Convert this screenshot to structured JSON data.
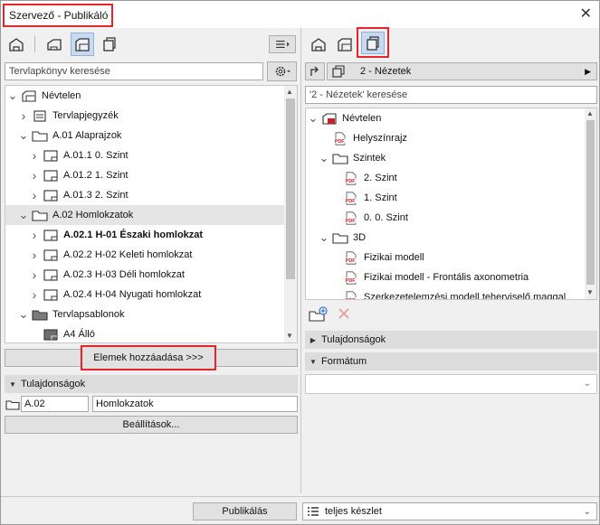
{
  "window": {
    "title": "Szervező - Publikáló",
    "close_glyph": "✕"
  },
  "left": {
    "toolbar": {
      "icons": [
        "project-map-icon",
        "view-map-icon",
        "layout-book-icon",
        "publisher-sets-icon",
        "menu-icon"
      ]
    },
    "search_placeholder": "Tervlapkönyv keresése",
    "tree": [
      {
        "label": "Névtelen",
        "level": 0,
        "twisty": "open",
        "icon": "book-icon",
        "bold": false,
        "highlight": false
      },
      {
        "label": "Tervlapjegyzék",
        "level": 1,
        "twisty": "closed",
        "icon": "layout-list-icon",
        "bold": false,
        "highlight": false
      },
      {
        "label": "A.01 Alaprajzok",
        "level": 1,
        "twisty": "open",
        "icon": "folder-icon",
        "bold": false,
        "highlight": false
      },
      {
        "label": "A.01.1 0. Szint",
        "level": 2,
        "twisty": "closed",
        "icon": "layout-icon",
        "bold": false,
        "highlight": false
      },
      {
        "label": "A.01.2 1. Szint",
        "level": 2,
        "twisty": "closed",
        "icon": "layout-icon",
        "bold": false,
        "highlight": false
      },
      {
        "label": "A.01.3 2. Szint",
        "level": 2,
        "twisty": "closed",
        "icon": "layout-icon",
        "bold": false,
        "highlight": false
      },
      {
        "label": "A.02 Homlokzatok",
        "level": 1,
        "twisty": "open",
        "icon": "folder-icon",
        "bold": false,
        "highlight": true
      },
      {
        "label": "A.02.1 H-01 Északi homlokzat",
        "level": 2,
        "twisty": "closed",
        "icon": "layout-icon",
        "bold": true,
        "highlight": false
      },
      {
        "label": "A.02.2 H-02 Keleti homlokzat",
        "level": 2,
        "twisty": "closed",
        "icon": "layout-icon",
        "bold": false,
        "highlight": false
      },
      {
        "label": "A.02.3 H-03 Déli homlokzat",
        "level": 2,
        "twisty": "closed",
        "icon": "layout-icon",
        "bold": false,
        "highlight": false
      },
      {
        "label": "A.02.4 H-04 Nyugati homlokzat",
        "level": 2,
        "twisty": "closed",
        "icon": "layout-icon",
        "bold": false,
        "highlight": false
      },
      {
        "label": "Tervlapsablonok",
        "level": 1,
        "twisty": "open",
        "icon": "folder-dark-icon",
        "bold": false,
        "highlight": false
      },
      {
        "label": "A4 Álló",
        "level": 2,
        "twisty": "none",
        "icon": "master-layout-icon",
        "bold": false,
        "highlight": false
      }
    ],
    "add_button": "Elemek hozzáadása >>>",
    "properties_header": "Tulajdonságok",
    "prop_id": "A.02",
    "prop_name": "Homlokzatok",
    "settings_button": "Beállítások..."
  },
  "right": {
    "toolbar": {
      "icons": [
        "project-map-icon",
        "layout-book-icon",
        "publisher-sets-icon"
      ]
    },
    "set_selector": "2 - Nézetek",
    "search_placeholder": "'2 - Nézetek' keresése",
    "tree": [
      {
        "label": "Névtelen",
        "level": 0,
        "twisty": "open",
        "icon": "publisher-root-icon"
      },
      {
        "label": "Helyszínrajz",
        "level": 1,
        "twisty": "none",
        "icon": "pdf-icon"
      },
      {
        "label": "Szintek",
        "level": 1,
        "twisty": "open",
        "icon": "folder-icon"
      },
      {
        "label": "2. Szint",
        "level": 2,
        "twisty": "none",
        "icon": "pdf-icon"
      },
      {
        "label": "1. Szint",
        "level": 2,
        "twisty": "none",
        "icon": "pdf-icon"
      },
      {
        "label": "0. 0. Szint",
        "level": 2,
        "twisty": "none",
        "icon": "pdf-icon"
      },
      {
        "label": "3D",
        "level": 1,
        "twisty": "open",
        "icon": "folder-icon"
      },
      {
        "label": "Fizikai modell",
        "level": 2,
        "twisty": "none",
        "icon": "pdf-icon"
      },
      {
        "label": "Fizikai modell - Frontális axonometria",
        "level": 2,
        "twisty": "none",
        "icon": "pdf-icon"
      },
      {
        "label": "Szerkezetelemzési modell teherviselő maggal",
        "level": 2,
        "twisty": "none",
        "icon": "pdf-icon"
      }
    ],
    "properties_header": "Tulajdonságok",
    "format_header": "Formátum"
  },
  "footer": {
    "publish_button": "Publikálás",
    "set_dropdown": "teljes készlet"
  },
  "colors": {
    "highlight_border": "#e8232b",
    "selected_bg": "#c9daf0",
    "pdf_red": "#c8202a"
  }
}
